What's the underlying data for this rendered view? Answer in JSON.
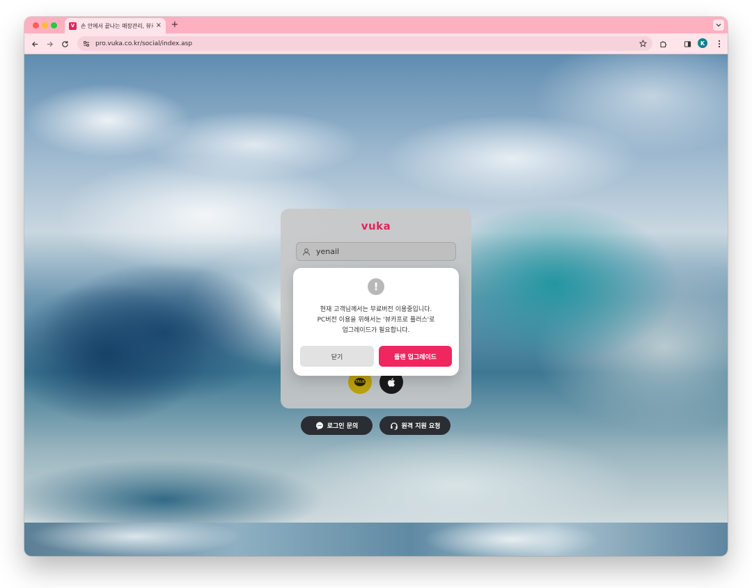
{
  "browser": {
    "tab": {
      "favicon_letter": "V",
      "title": "손 안에서 끝나는 매장관리, 뷰카"
    },
    "new_tab_symbol": "+",
    "close_symbol": "×",
    "url": "pro.vuka.co.kr/social/index.asp",
    "profile_initial": "K",
    "icons": [
      "back-icon",
      "forward-icon",
      "reload-icon",
      "site-settings-icon",
      "bookmark-star-icon",
      "extensions-icon",
      "side-panel-icon",
      "more-icon",
      "tab-menu-chevron-icon"
    ]
  },
  "login": {
    "logo": "vuka",
    "id_value": "yenail",
    "social": {
      "kakao_text": "TALK"
    },
    "buttons": {
      "login_inquiry": "로그인 문의",
      "remote_support": "원격 지원 요청"
    }
  },
  "modal": {
    "icon": "!",
    "message_lines": [
      "현재 고객님께서는 무료버전 이용중입니다.",
      "PC버전 이용을 위해서는 '뷰카프로 플러스'로",
      "업그레이드가 필요합니다."
    ],
    "close_label": "닫기",
    "upgrade_label": "플랜 업그레이드"
  },
  "colors": {
    "brand": "#e0245e",
    "upgrade_button": "#f0265f",
    "tabstrip": "#ffb0c0",
    "kakao": "#bba20c"
  }
}
